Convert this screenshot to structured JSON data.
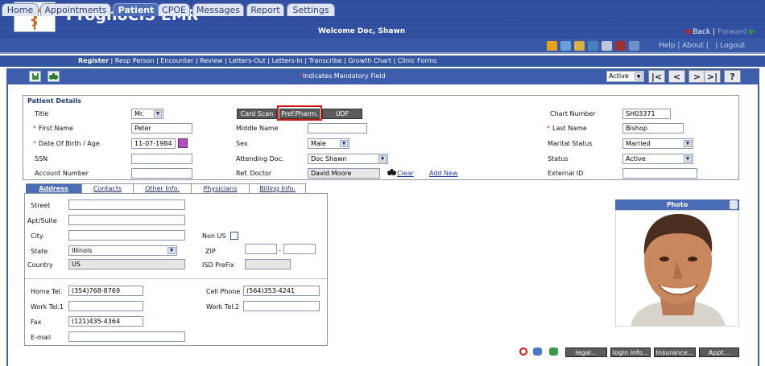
{
  "app": {
    "title": "PrognoCIS EMR",
    "welcome": "Welcome Doc, Shawn",
    "back": "Back",
    "forward": "Forward"
  },
  "tabs": [
    "Home",
    "Appointments",
    "Patient",
    "CPOE",
    "Messages",
    "Report",
    "Settings"
  ],
  "active_tab": "Patient",
  "help_links": "Help | About |   | Logout",
  "subnav": {
    "active": "Register",
    "rest": " | Resp Person | Encounter | Review | Letters-Out | Letters-In | Transcribe | Growth Chart | Clinic Forms"
  },
  "toolbar": {
    "mandatory_star": "*",
    "mandatory_text": "Indicates Mandatory Field",
    "status_value": "Active",
    "nav_first": "|<",
    "nav_prev": "<",
    "nav_next": ">",
    "nav_last": ">|",
    "nav_help": "?"
  },
  "patient": {
    "section_title": "Patient Details",
    "labels": {
      "title": "Title",
      "first_name": "First Name",
      "dob": "Date Of Birth / Age",
      "ssn": "SSN",
      "account": "Account Number",
      "middle_name": "Middle Name",
      "sex": "Sex",
      "attending": "Attending Doc.",
      "ref_doctor": "Ref. Doctor",
      "chart_number": "Chart Number",
      "last_name": "Last Name",
      "marital": "Marital Status",
      "status": "Status",
      "external_id": "External ID"
    },
    "values": {
      "title": "Mr.",
      "first_name": "Peter",
      "dob": "11-07-1984",
      "ssn": "",
      "account": "",
      "middle_name": "",
      "sex": "Male",
      "attending": "Doc Shawn",
      "ref_doctor": "David Moore",
      "chart_number": "SH03371",
      "last_name": "Bishop",
      "marital": "Married",
      "status": "Active",
      "external_id": ""
    },
    "buttons": {
      "card_scan": "Card Scan",
      "pref_pharm": "Pref.Pharm.",
      "udf": "UDF"
    },
    "clear": "Clear",
    "add_new": "Add New"
  },
  "subtabs": [
    "Address",
    "Contacts",
    "Other Info.",
    "Physicians",
    "Billing Info."
  ],
  "address": {
    "labels": {
      "street": "Street",
      "apt": "Apt/Suite",
      "city": "City",
      "state": "State",
      "country": "Country",
      "non_us": "Non US",
      "zip": "ZIP",
      "isd": "ISD PreFix",
      "home_tel": "Home Tel.",
      "work_tel1": "Work Tel.1",
      "fax": "Fax",
      "email": "E-mail",
      "cell": "Cell Phone",
      "work_tel2": "Work Tel.2"
    },
    "values": {
      "street": "",
      "apt": "",
      "city": "",
      "state": "Illinois",
      "country": "US",
      "zip1": "",
      "zip_sep": "-",
      "zip2": "",
      "isd": "",
      "home_tel": "(354)768-8769",
      "work_tel1": "",
      "fax": "(121)435-4364",
      "email": "",
      "cell": "(564)353-4241",
      "work_tel2": ""
    }
  },
  "photo": {
    "title": "Photo"
  },
  "bottom_buttons": [
    "legal...",
    "login info...",
    "Insurance...",
    "Appt..."
  ]
}
